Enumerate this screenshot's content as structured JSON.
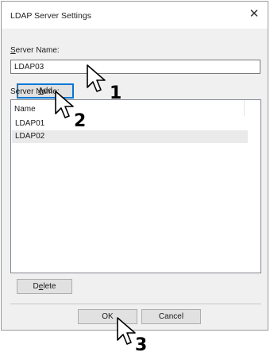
{
  "dialog": {
    "title": "LDAP Server Settings",
    "close_glyph": "✕"
  },
  "server_name": {
    "label_mnemonic": "S",
    "label_rest": "erver Name:",
    "value": "LDAP03"
  },
  "add_button": {
    "mnemonic": "A",
    "rest": "dd"
  },
  "server_list": {
    "label": "Server Name:",
    "column_header": "Name",
    "items": [
      "LDAP01",
      "LDAP02"
    ],
    "selected_index": 1
  },
  "delete_button": {
    "prefix": "D",
    "mnemonic": "e",
    "rest": "lete"
  },
  "ok_button": {
    "label": "OK"
  },
  "cancel_button": {
    "label": "Cancel"
  },
  "callouts": [
    "1",
    "2",
    "3"
  ],
  "icons": {
    "pointer": "arrow-pointer-icon"
  }
}
